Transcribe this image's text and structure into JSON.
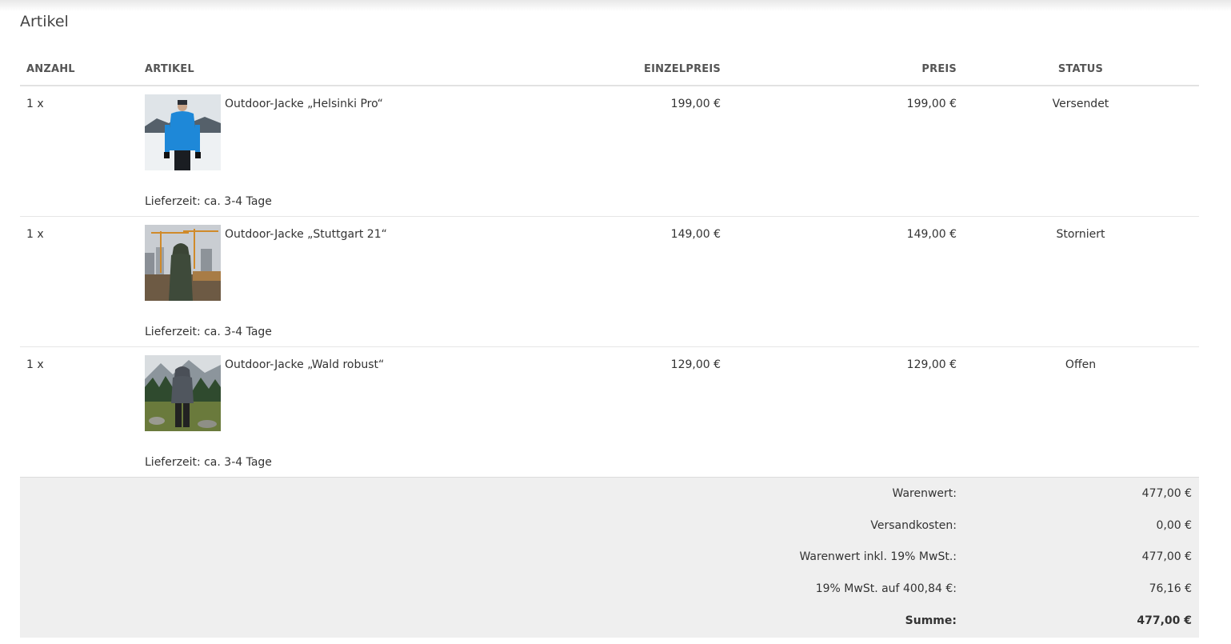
{
  "section_title": "Artikel",
  "columns": {
    "quantity": "ANZAHL",
    "article": "ARTIKEL",
    "unit_price": "EINZELPREIS",
    "price": "PREIS",
    "status": "STATUS"
  },
  "items": [
    {
      "quantity": "1 x",
      "name": "Outdoor-Jacke „Helsinki Pro“",
      "unit_price": "199,00 €",
      "price": "199,00 €",
      "status": "Versendet",
      "delivery": "Lieferzeit: ca. 3-4 Tage"
    },
    {
      "quantity": "1 x",
      "name": "Outdoor-Jacke „Stuttgart 21“",
      "unit_price": "149,00 €",
      "price": "149,00 €",
      "status": "Storniert",
      "delivery": "Lieferzeit: ca. 3-4 Tage"
    },
    {
      "quantity": "1 x",
      "name": "Outdoor-Jacke „Wald robust“",
      "unit_price": "129,00 €",
      "price": "129,00 €",
      "status": "Offen",
      "delivery": "Lieferzeit: ca. 3-4 Tage"
    }
  ],
  "totals": [
    {
      "label": "Warenwert:",
      "value": "477,00 €"
    },
    {
      "label": "Versandkosten:",
      "value": "0,00 €"
    },
    {
      "label": "Warenwert inkl. 19% MwSt.:",
      "value": "477,00 €"
    },
    {
      "label": "19% MwSt. auf 400,84 €:",
      "value": "76,16 €"
    },
    {
      "label": "Summe:",
      "value": "477,00 €"
    }
  ]
}
